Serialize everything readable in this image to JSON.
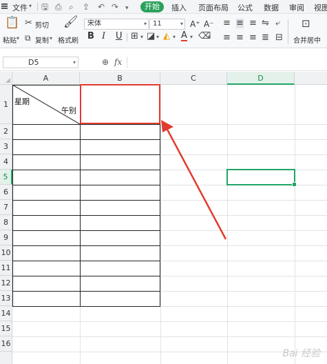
{
  "menubar": {
    "file_label": "文件",
    "tabs": [
      {
        "label": "开始",
        "active": true
      },
      {
        "label": "插入"
      },
      {
        "label": "页面布局"
      },
      {
        "label": "公式"
      },
      {
        "label": "数据"
      },
      {
        "label": "审阅"
      },
      {
        "label": "视图"
      }
    ],
    "quick_icons": [
      "save-icon",
      "print-icon",
      "print-preview-icon",
      "export-icon",
      "undo-icon",
      "redo-icon",
      "more-icon"
    ],
    "accent_color": "#2aa15b"
  },
  "ribbon": {
    "paste_label": "粘贴",
    "cut_label": "剪切",
    "copy_label": "复制",
    "format_painter_label": "格式刷",
    "font_name": "宋体",
    "font_size": "11",
    "increase_font": "A⁺",
    "decrease_font": "A⁻",
    "bold": "B",
    "italic": "I",
    "underline": "U",
    "font_color_glyph": "A",
    "merge_label": "合并居中"
  },
  "formula_bar": {
    "name_box": "D5",
    "fx_label": "fx",
    "value": ""
  },
  "sheet": {
    "columns": [
      "A",
      "B",
      "C",
      "D"
    ],
    "selected_column": "D",
    "rows": [
      "1",
      "2",
      "3",
      "4",
      "5",
      "6",
      "7",
      "8",
      "9",
      "10",
      "11",
      "12",
      "13",
      "14",
      "15",
      "16"
    ],
    "selected_row": "5",
    "active_cell": "D5",
    "cells": {
      "A1_top": "星期",
      "A1_bottom": "午别"
    },
    "highlight_color": "#e23a2e",
    "selection_color": "#21a365"
  },
  "watermark": "Bai 经验"
}
